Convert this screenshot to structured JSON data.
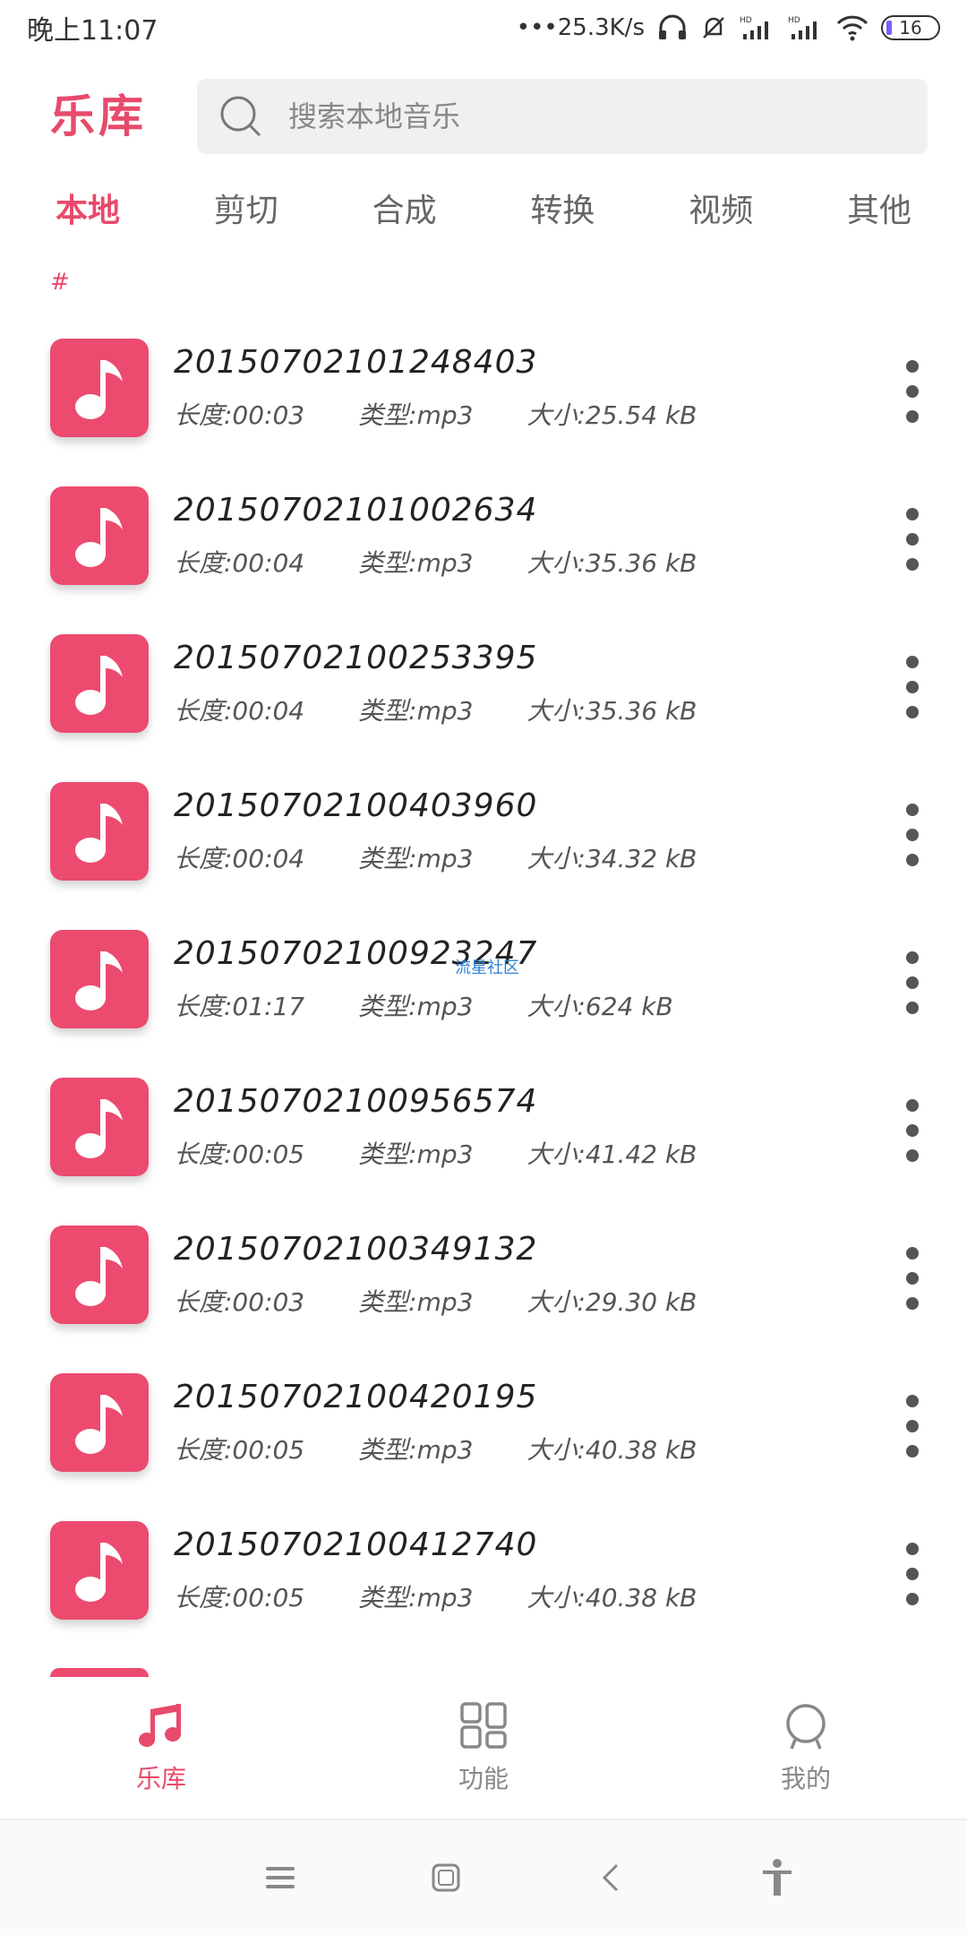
{
  "status": {
    "time": "晚上11:07",
    "speed": "•••25.3K/s",
    "battery": "16"
  },
  "header": {
    "title": "乐库",
    "search_placeholder": "搜索本地音乐"
  },
  "tabs": [
    {
      "label": "本地",
      "active": true
    },
    {
      "label": "剪切"
    },
    {
      "label": "合成"
    },
    {
      "label": "转换"
    },
    {
      "label": "视频"
    },
    {
      "label": "其他"
    }
  ],
  "section": "#",
  "songs": [
    {
      "title": "20150702101248403",
      "length": "长度:00:03",
      "type": "类型:mp3",
      "size": "大小:25.54 kB"
    },
    {
      "title": "20150702101002634",
      "length": "长度:00:04",
      "type": "类型:mp3",
      "size": "大小:35.36 kB"
    },
    {
      "title": "20150702100253395",
      "length": "长度:00:04",
      "type": "类型:mp3",
      "size": "大小:35.36 kB"
    },
    {
      "title": "20150702100403960",
      "length": "长度:00:04",
      "type": "类型:mp3",
      "size": "大小:34.32 kB"
    },
    {
      "title": "20150702100923247",
      "length": "长度:01:17",
      "type": "类型:mp3",
      "size": "大小:624 kB"
    },
    {
      "title": "20150702100956574",
      "length": "长度:00:05",
      "type": "类型:mp3",
      "size": "大小:41.42 kB"
    },
    {
      "title": "20150702100349132",
      "length": "长度:00:03",
      "type": "类型:mp3",
      "size": "大小:29.30 kB"
    },
    {
      "title": "20150702100420195",
      "length": "长度:00:05",
      "type": "类型:mp3",
      "size": "大小:40.38 kB"
    },
    {
      "title": "20150702100412740",
      "length": "长度:00:05",
      "type": "类型:mp3",
      "size": "大小:40.38 kB"
    }
  ],
  "watermark": "流星社区",
  "bottom_nav": [
    {
      "label": "乐库",
      "icon": "music-notes-icon",
      "active": true
    },
    {
      "label": "功能",
      "icon": "grid-icon"
    },
    {
      "label": "我的",
      "icon": "profile-icon"
    }
  ],
  "colors": {
    "accent": "#e84a6b",
    "thumb": "#ec4b6f"
  }
}
